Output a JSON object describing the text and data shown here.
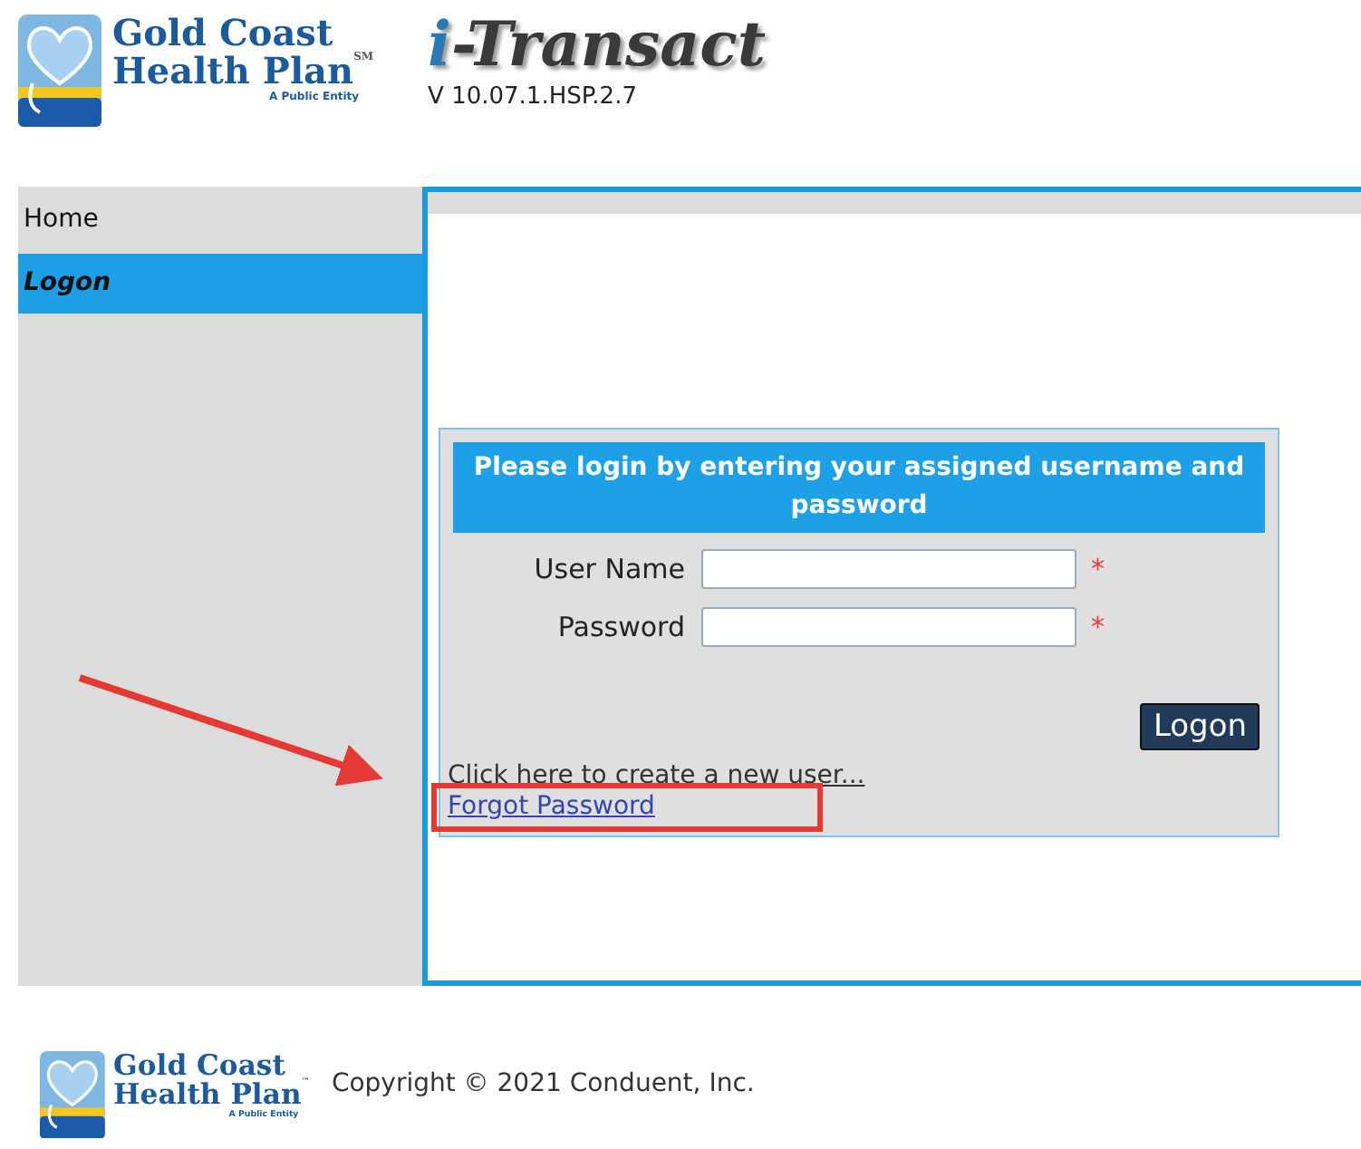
{
  "header": {
    "logo": {
      "line_1": "Gold Coast",
      "line_2": "Health Plan",
      "mark": "SM",
      "tagline": "A Public Entity"
    },
    "product": {
      "prefix": "i",
      "name": "-Transact"
    },
    "version": "V 10.07.1.HSP.2.7"
  },
  "sidebar": {
    "items": [
      {
        "label": "Home",
        "selected": false
      },
      {
        "label": "Logon",
        "selected": true
      }
    ]
  },
  "login": {
    "heading": "Please login by entering your assigned username and password",
    "fields": [
      {
        "label": "User Name",
        "required_mark": "*"
      },
      {
        "label": "Password",
        "required_mark": "*"
      }
    ],
    "button": "Logon",
    "links": [
      {
        "text": "Click here to create a new user...",
        "highlighted": false
      },
      {
        "text": "Forgot Password",
        "highlighted": true
      }
    ]
  },
  "annotation": {
    "arrow": true
  },
  "footer": {
    "logo": {
      "line_1": "Gold Coast",
      "line_2": "Health Plan",
      "mark": "™",
      "tagline": "A Public Entity"
    },
    "copyright": "Copyright © 2021 Conduent, Inc."
  }
}
